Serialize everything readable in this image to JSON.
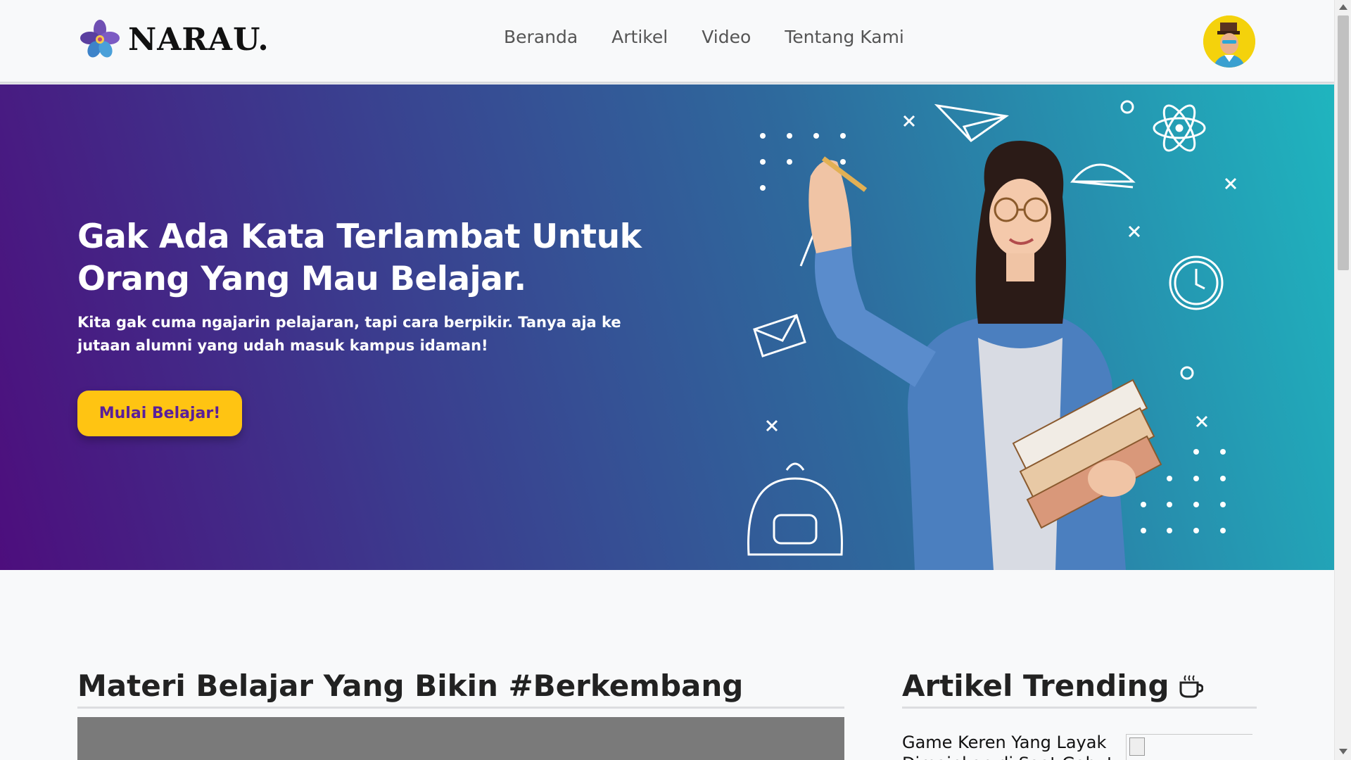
{
  "navbar": {
    "brand": "NARAU.",
    "links": [
      "Beranda",
      "Artikel",
      "Video",
      "Tentang Kami"
    ]
  },
  "hero": {
    "title": "Gak Ada Kata Terlambat Untuk Orang Yang Mau Belajar.",
    "subtitle": "Kita gak cuma ngajarin pelajaran, tapi cara berpikir. Tanya aja ke jutaan alumni yang udah masuk kampus idaman!",
    "cta_label": "Mulai Belajar!"
  },
  "materi": {
    "title": "Materi Belajar Yang Bikin #Berkembang"
  },
  "trending": {
    "title": "Artikel Trending",
    "icon": "coffee-cup-icon",
    "items": [
      {
        "title": "Game Keren Yang Layak Dimainkan di Saat Gabut"
      }
    ]
  },
  "colors": {
    "accent": "#ffc412",
    "brand_purple": "#5a1f9a",
    "hero_gradient_start": "#4d0e7d",
    "hero_gradient_end": "#1fb5bf"
  }
}
